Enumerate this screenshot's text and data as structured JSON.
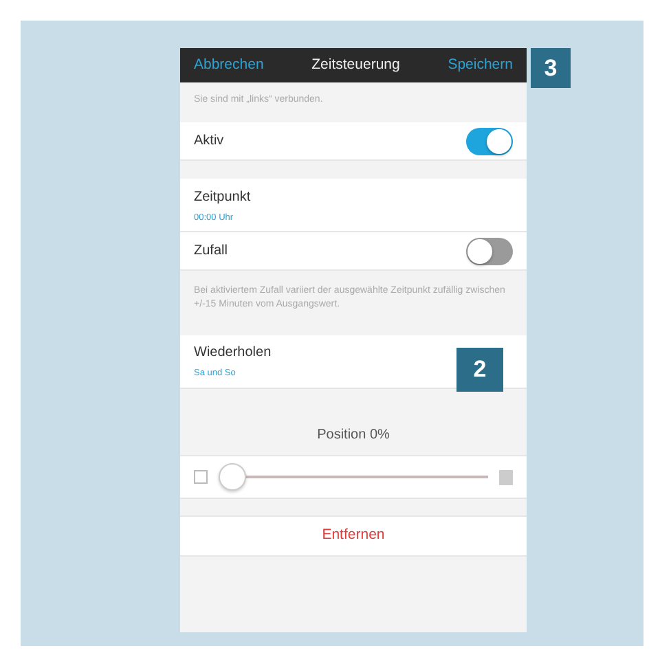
{
  "header": {
    "cancel": "Abbrechen",
    "title": "Zeitsteuerung",
    "save": "Speichern"
  },
  "connection_note": "Sie sind mit „links“ verbunden.",
  "settings": [
    {
      "kind": "toggle",
      "label": "Aktiv",
      "on": true
    },
    {
      "kind": "value",
      "label": "Zeitpunkt",
      "value": "00:00 Uhr"
    },
    {
      "kind": "toggle",
      "label": "Zufall",
      "on": false
    },
    {
      "kind": "note",
      "text": "Bei aktiviertem Zufall variiert der ausgewählte Zeitpunkt zufällig zwischen +/-15 Minuten vom Ausgangswert."
    },
    {
      "kind": "value",
      "label": "Wiederholen",
      "value": "Sa und So"
    }
  ],
  "position": {
    "label": "Position 0%",
    "level": 0
  },
  "remove_button": "Entfernen",
  "callouts": [
    {
      "number": "3"
    },
    {
      "number": "2"
    }
  ]
}
